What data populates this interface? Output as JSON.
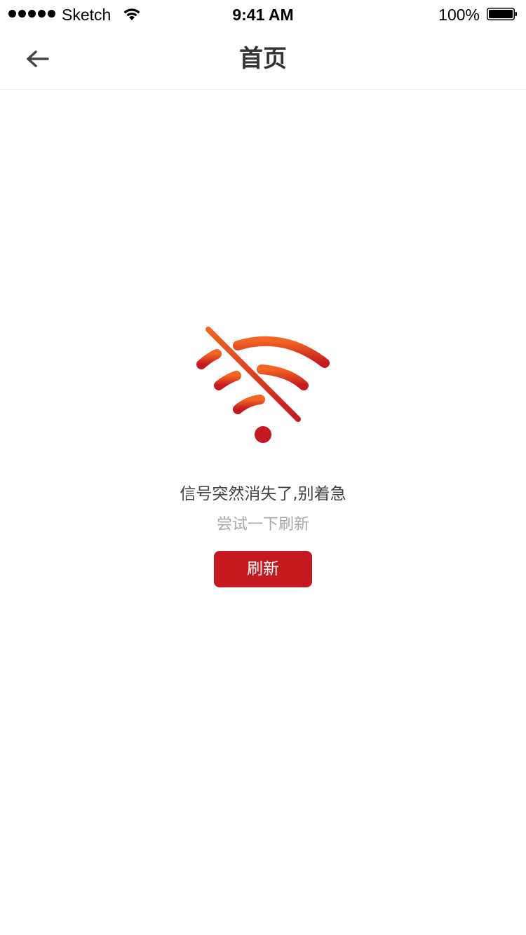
{
  "status_bar": {
    "carrier": "Sketch",
    "time": "9:41 AM",
    "battery": "100%",
    "signal_icon": "signal-dots-icon",
    "wifi_icon": "wifi-icon",
    "battery_icon": "battery-icon"
  },
  "nav": {
    "title": "首页",
    "back_icon": "arrow-left-icon"
  },
  "empty_state": {
    "icon": "wifi-off-icon",
    "headline": "信号突然消失了,别着急",
    "subline": "尝试一下刷新",
    "button_label": "刷新"
  },
  "colors": {
    "accent": "#c41920",
    "icon_gradient_top": "#f26522",
    "icon_gradient_bottom": "#c41920",
    "headline_text": "#444444",
    "subline_text": "#aaaaaa"
  }
}
